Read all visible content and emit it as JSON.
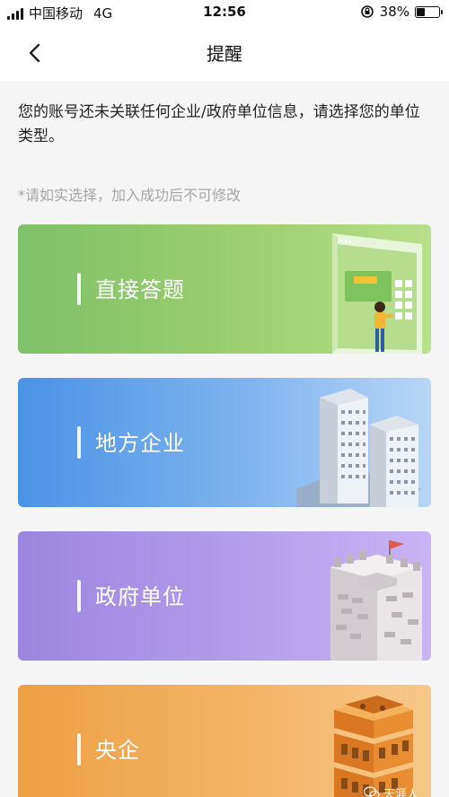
{
  "status_bar": {
    "carrier": "中国移动",
    "network": "4G",
    "time": "12:56",
    "battery_percent": "38%",
    "battery_level": 0.38
  },
  "nav": {
    "title": "提醒"
  },
  "notice": "您的账号还未关联任何企业/政府单位信息，请选择您的单位类型。",
  "hint": "*请如实选择，加入成功后不可修改",
  "cards": [
    {
      "label": "直接答题",
      "color": "#8cc76c"
    },
    {
      "label": "地方企业",
      "color": "#5e9fe9"
    },
    {
      "label": "政府单位",
      "color": "#a692e5"
    },
    {
      "label": "央企",
      "color": "#f0a752"
    }
  ],
  "watermark": "天涯人"
}
